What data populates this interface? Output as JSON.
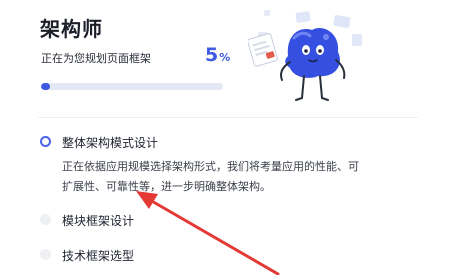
{
  "header": {
    "title": "架构师",
    "subtitle": "正在为您规划页面框架",
    "progress_value": "5",
    "progress_unit": "%",
    "progress_fraction": 0.05,
    "accent_color": "#3d5ae0"
  },
  "steps": [
    {
      "label": "整体架构模式设计",
      "status": "active",
      "description": "正在依据应用规模选择架构形式，我们将考量应用的性能、可扩展性、可靠性等，进一步明确整体架构。"
    },
    {
      "label": "模块框架设计",
      "status": "pending"
    },
    {
      "label": "技术框架选型",
      "status": "pending"
    }
  ],
  "illustration": {
    "icon": "robot-mascot-icon"
  },
  "annotation": {
    "icon": "red-arrow-icon",
    "color": "#e53935"
  }
}
